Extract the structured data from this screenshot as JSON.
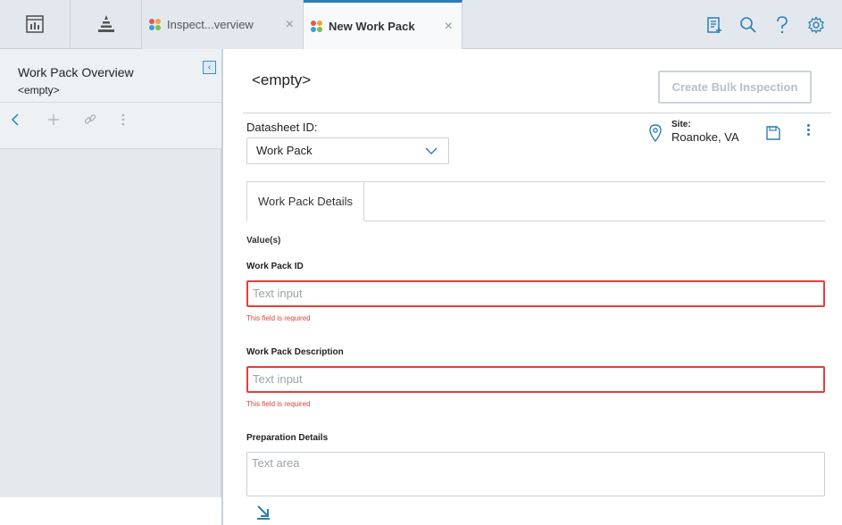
{
  "topbar": {
    "tabs": [
      {
        "label": "Inspect...verview",
        "active": false
      },
      {
        "label": "New Work Pack",
        "active": true
      }
    ],
    "close_glyph": "×",
    "icons": [
      "dashboard-icon",
      "pyramid-icon",
      "checklist-add-icon",
      "search-icon",
      "help-icon",
      "settings-icon"
    ]
  },
  "left_panel": {
    "title": "Work Pack Overview",
    "subtitle": "<empty>",
    "collapse_glyph": "‹",
    "toolbar": [
      "back-icon",
      "add-icon",
      "link-icon",
      "more-icon"
    ]
  },
  "main": {
    "page_title": "<empty>",
    "bulk_button": "Create Bulk Inspection",
    "datasheet_label": "Datasheet ID:",
    "datasheet_value": "Work Pack",
    "site_label": "Site:",
    "site_value": "Roanoke, VA",
    "tab_label": "Work Pack Details",
    "values_label": "Value(s)",
    "fields": [
      {
        "label": "Work Pack ID",
        "placeholder": "Text input",
        "error": "This field is required"
      },
      {
        "label": "Work Pack Description",
        "placeholder": "Text input",
        "error": "This field is required"
      }
    ],
    "prep_label": "Preparation Details",
    "prep_placeholder": "Text area"
  },
  "colors": {
    "accent": "#2b7fb3",
    "error": "#e0413a",
    "topbar_bg": "#e3e8ee"
  }
}
